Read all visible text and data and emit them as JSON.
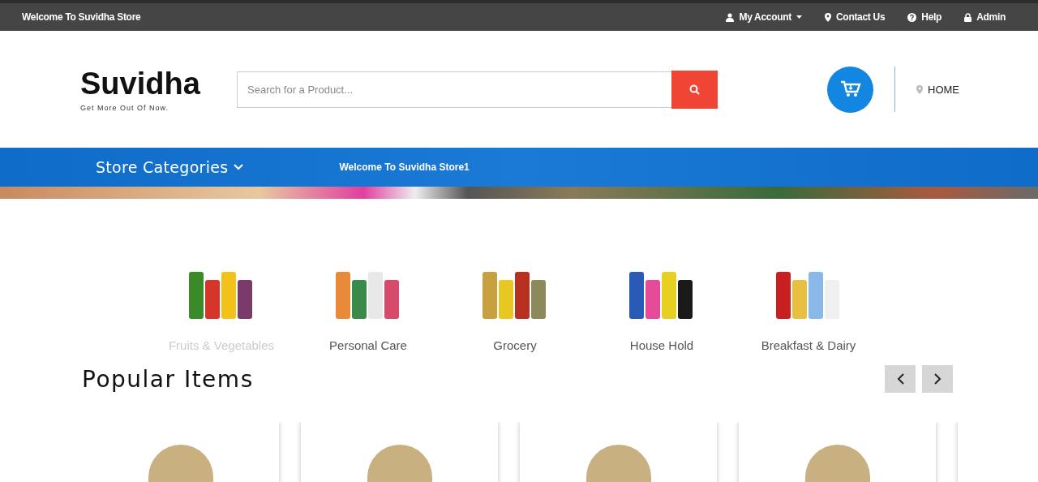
{
  "top_bar": {
    "welcome": "Welcome To Suvidha Store",
    "links": [
      {
        "kind": "account",
        "label": "My Account",
        "dropdown": true
      },
      {
        "kind": "contact",
        "label": "Contact Us",
        "dropdown": false
      },
      {
        "kind": "help",
        "label": "Help",
        "dropdown": false
      },
      {
        "kind": "admin",
        "label": "Admin",
        "dropdown": false
      }
    ]
  },
  "header": {
    "logo": "Suvidha",
    "tagline": "Get More Out Of Now.",
    "search": {
      "placeholder": "Search for a Product..."
    },
    "nav_link": "HOME"
  },
  "category_bar": {
    "menu_label": "Store Categories",
    "welcome": "Welcome To Suvidha Store1"
  },
  "categories": [
    {
      "label": "Fruits & Vegetables",
      "selected": true,
      "kind": "fruits"
    },
    {
      "label": "Personal Care",
      "selected": false,
      "kind": "personal"
    },
    {
      "label": "Grocery",
      "selected": false,
      "kind": "grocery"
    },
    {
      "label": "House Hold",
      "selected": false,
      "kind": "household"
    },
    {
      "label": "Breakfast & Dairy",
      "selected": false,
      "kind": "breakfast"
    }
  ],
  "popular_items": {
    "title": "Popular Items",
    "cards": [
      {
        "kind": "product"
      },
      {
        "kind": "product"
      },
      {
        "kind": "product"
      },
      {
        "kind": "product"
      },
      {
        "kind": "partial"
      }
    ]
  }
}
